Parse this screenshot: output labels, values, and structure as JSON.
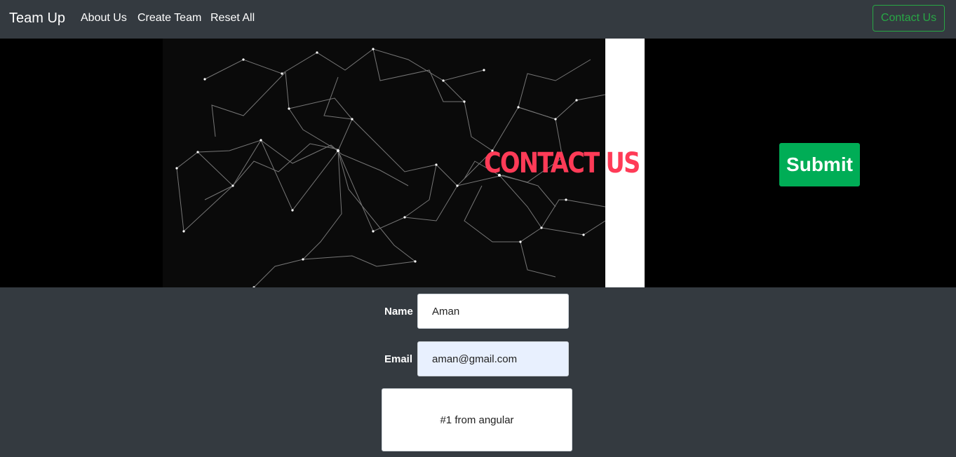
{
  "navbar": {
    "brand": "Team Up",
    "links": [
      "About Us",
      "Create Team",
      "Reset All"
    ],
    "contact_button": "Contact Us"
  },
  "hero": {
    "title": "CONTACT US",
    "submit_label": "Submit"
  },
  "form": {
    "name_label": "Name",
    "name_value": "Aman",
    "email_label": "Email",
    "email_value": "aman@gmail.com",
    "message_value": "#1 from angular"
  },
  "colors": {
    "navbar_bg": "#343a40",
    "accent_green": "#28a745",
    "submit_green": "#00ad56",
    "title_red": "#ff3b57"
  }
}
